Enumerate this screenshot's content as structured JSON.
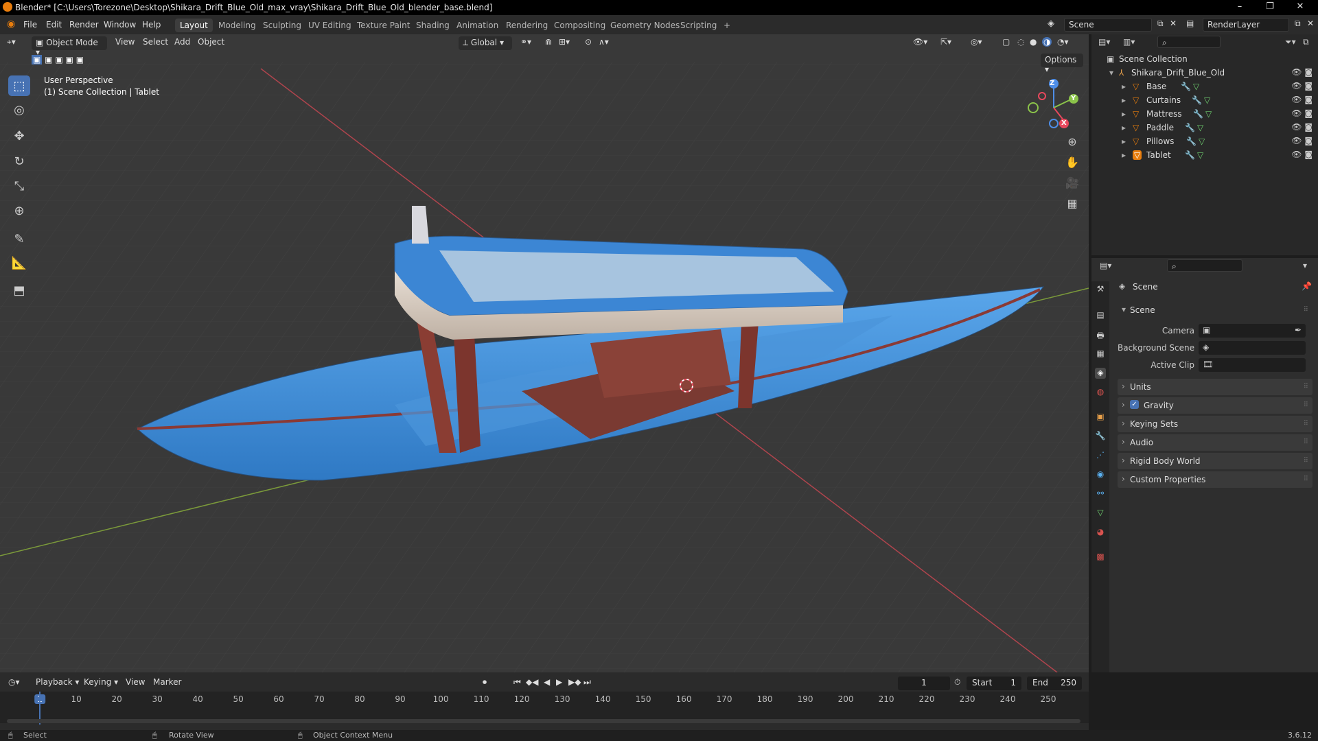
{
  "window": {
    "title": "Blender* [C:\\Users\\Torezone\\Desktop\\Shikara_Drift_Blue_Old_max_vray\\Shikara_Drift_Blue_Old_blender_base.blend]",
    "minimize": "–",
    "maximize": "❐",
    "close": "✕"
  },
  "menu": {
    "items": [
      "File",
      "Edit",
      "Render",
      "Window",
      "Help"
    ]
  },
  "workspaces": {
    "tabs": [
      "Layout",
      "Modeling",
      "Sculpting",
      "UV Editing",
      "Texture Paint",
      "Shading",
      "Animation",
      "Rendering",
      "Compositing",
      "Geometry Nodes",
      "Scripting"
    ],
    "add": "+",
    "active": "Layout"
  },
  "scene_selector": {
    "value": "Scene"
  },
  "view_layer": {
    "value": "RenderLayer"
  },
  "viewport_header": {
    "mode": "Object Mode",
    "menus": [
      "View",
      "Select",
      "Add",
      "Object"
    ],
    "orientation": "Global",
    "options": "Options"
  },
  "viewport": {
    "perspective": "User Perspective",
    "collection_info": "(1) Scene Collection | Tablet",
    "gizmo": {
      "x": "X",
      "y": "Y",
      "z": "Z"
    }
  },
  "outliner": {
    "root": "Scene Collection",
    "collection": "Shikara_Drift_Blue_Old",
    "objects": [
      "Base",
      "Curtains",
      "Mattress",
      "Paddle",
      "Pillows",
      "Tablet"
    ]
  },
  "properties": {
    "header": "Scene",
    "section": "Scene",
    "fields": [
      {
        "label": "Camera",
        "value": ""
      },
      {
        "label": "Background Scene",
        "value": ""
      },
      {
        "label": "Active Clip",
        "value": ""
      }
    ],
    "panels": [
      "Units",
      "Gravity",
      "Keying Sets",
      "Audio",
      "Rigid Body World",
      "Custom Properties"
    ],
    "gravity_checked": true
  },
  "timeline": {
    "menus": [
      "Playback",
      "Keying",
      "View",
      "Marker"
    ],
    "current_frame": "1",
    "start_label": "Start",
    "start": "1",
    "end_label": "End",
    "end": "250",
    "ticks": [
      "1",
      "10",
      "20",
      "30",
      "40",
      "50",
      "60",
      "70",
      "80",
      "90",
      "100",
      "110",
      "120",
      "130",
      "140",
      "150",
      "160",
      "170",
      "180",
      "190",
      "200",
      "210",
      "220",
      "230",
      "240",
      "250"
    ]
  },
  "statusbar": {
    "select": "Select",
    "rotate": "Rotate View",
    "context": "Object Context Menu",
    "version": "3.6.12"
  },
  "colors": {
    "accent": "#4772b3",
    "boat_blue": "#3f8fd8",
    "canopy": "#d8cfc6",
    "cushion": "#7a3a32",
    "axis_x": "#e8485d",
    "axis_y": "#8bc34a",
    "axis_z": "#4e8ee8"
  }
}
